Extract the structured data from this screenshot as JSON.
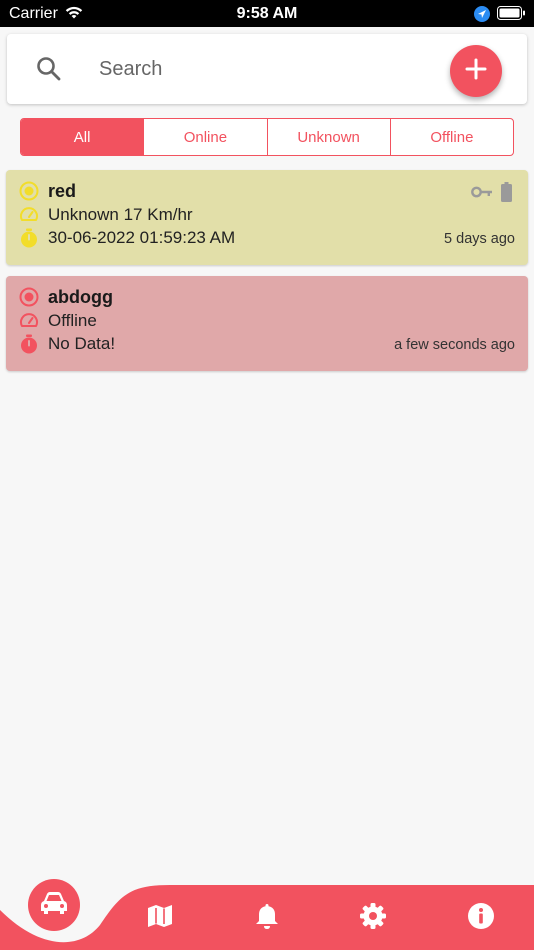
{
  "status_bar": {
    "carrier": "Carrier",
    "time": "9:58 AM"
  },
  "search": {
    "placeholder": "Search"
  },
  "tabs": [
    {
      "label": "All",
      "active": true
    },
    {
      "label": "Online",
      "active": false
    },
    {
      "label": "Unknown",
      "active": false
    },
    {
      "label": "Offline",
      "active": false
    }
  ],
  "devices": [
    {
      "name": "red",
      "status_line": "Unknown 17 Km/hr",
      "datetime": "30-06-2022 01:59:23 AM",
      "ago": "5 days ago",
      "color": "#e2dfa9",
      "icon_color": "#f2dd2a"
    },
    {
      "name": "abdogg",
      "status_line": "Offline",
      "datetime": "No Data!",
      "ago": "a few seconds ago",
      "color": "#e0a8a9",
      "icon_color": "#f2525f"
    }
  ],
  "bottom_nav": {
    "items": [
      "car-icon",
      "map-icon",
      "bell-icon",
      "gear-icon",
      "info-icon"
    ],
    "active": "car-icon"
  },
  "colors": {
    "accent": "#f2525f",
    "background": "#f7f7f7"
  }
}
